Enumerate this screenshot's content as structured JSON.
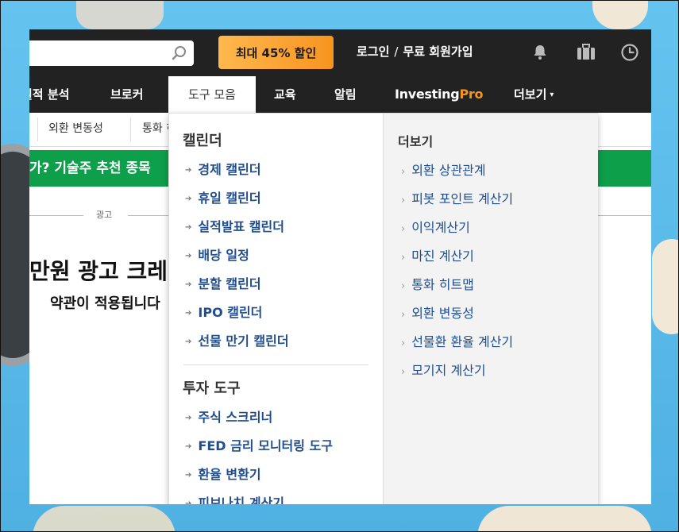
{
  "header": {
    "promo_label": "최대 45% 할인",
    "login_label": "로그인",
    "auth_separator": "/",
    "signup_label": "무료 회원가입",
    "icons": [
      "search-icon",
      "bell-icon",
      "briefcase-icon",
      "clock-icon"
    ]
  },
  "main_nav": {
    "items": [
      {
        "label": "실적 분석"
      },
      {
        "label": "브로커"
      },
      {
        "label": "도구 모음"
      },
      {
        "label": "교육"
      },
      {
        "label": "알림"
      },
      {
        "label": "더보기"
      }
    ],
    "brand": {
      "investing": "Investing",
      "pro": "Pro"
    }
  },
  "sub_nav": {
    "items": [
      {
        "label": "외환 변동성"
      },
      {
        "label": "통화 히트맵"
      }
    ]
  },
  "banner": {
    "text": "가? 기술주 추천 종목"
  },
  "ad": {
    "label": "광고",
    "headline": "만원 광고 크레딧",
    "subline": "약관이 적용됩니다"
  },
  "dropdown": {
    "calendar": {
      "heading": "캘린더",
      "items": [
        {
          "label": "경제 캘린더"
        },
        {
          "label": "휴일 캘린더"
        },
        {
          "label": "실적발표 캘린더"
        },
        {
          "label": "배당 일정"
        },
        {
          "label": "분할 캘린더"
        },
        {
          "label": "IPO 캘린더"
        },
        {
          "label": "선물 만기 캘린더"
        }
      ]
    },
    "tools": {
      "heading": "투자 도구",
      "items": [
        {
          "label": "주식 스크리너"
        },
        {
          "label": "FED 금리 모니터링 도구"
        },
        {
          "label": "환율 변환기"
        },
        {
          "label": "피보나치 계산기"
        }
      ]
    },
    "more": {
      "heading": "더보기",
      "items": [
        {
          "label": "외환 상관관계"
        },
        {
          "label": "피봇 포인트 계산기"
        },
        {
          "label": "이익계산기"
        },
        {
          "label": "마진 계산기"
        },
        {
          "label": "통화 히트맵"
        },
        {
          "label": "외환 변동성"
        },
        {
          "label": "선물환 환율 계산기"
        },
        {
          "label": "모기지 계산기"
        }
      ]
    },
    "arrow_glyph": "➔",
    "chevron_glyph": "›"
  },
  "colors": {
    "topbar": "#222222",
    "promo": "#f79420",
    "link": "#1f4d8f",
    "banner_green": "#0e9f4b"
  }
}
